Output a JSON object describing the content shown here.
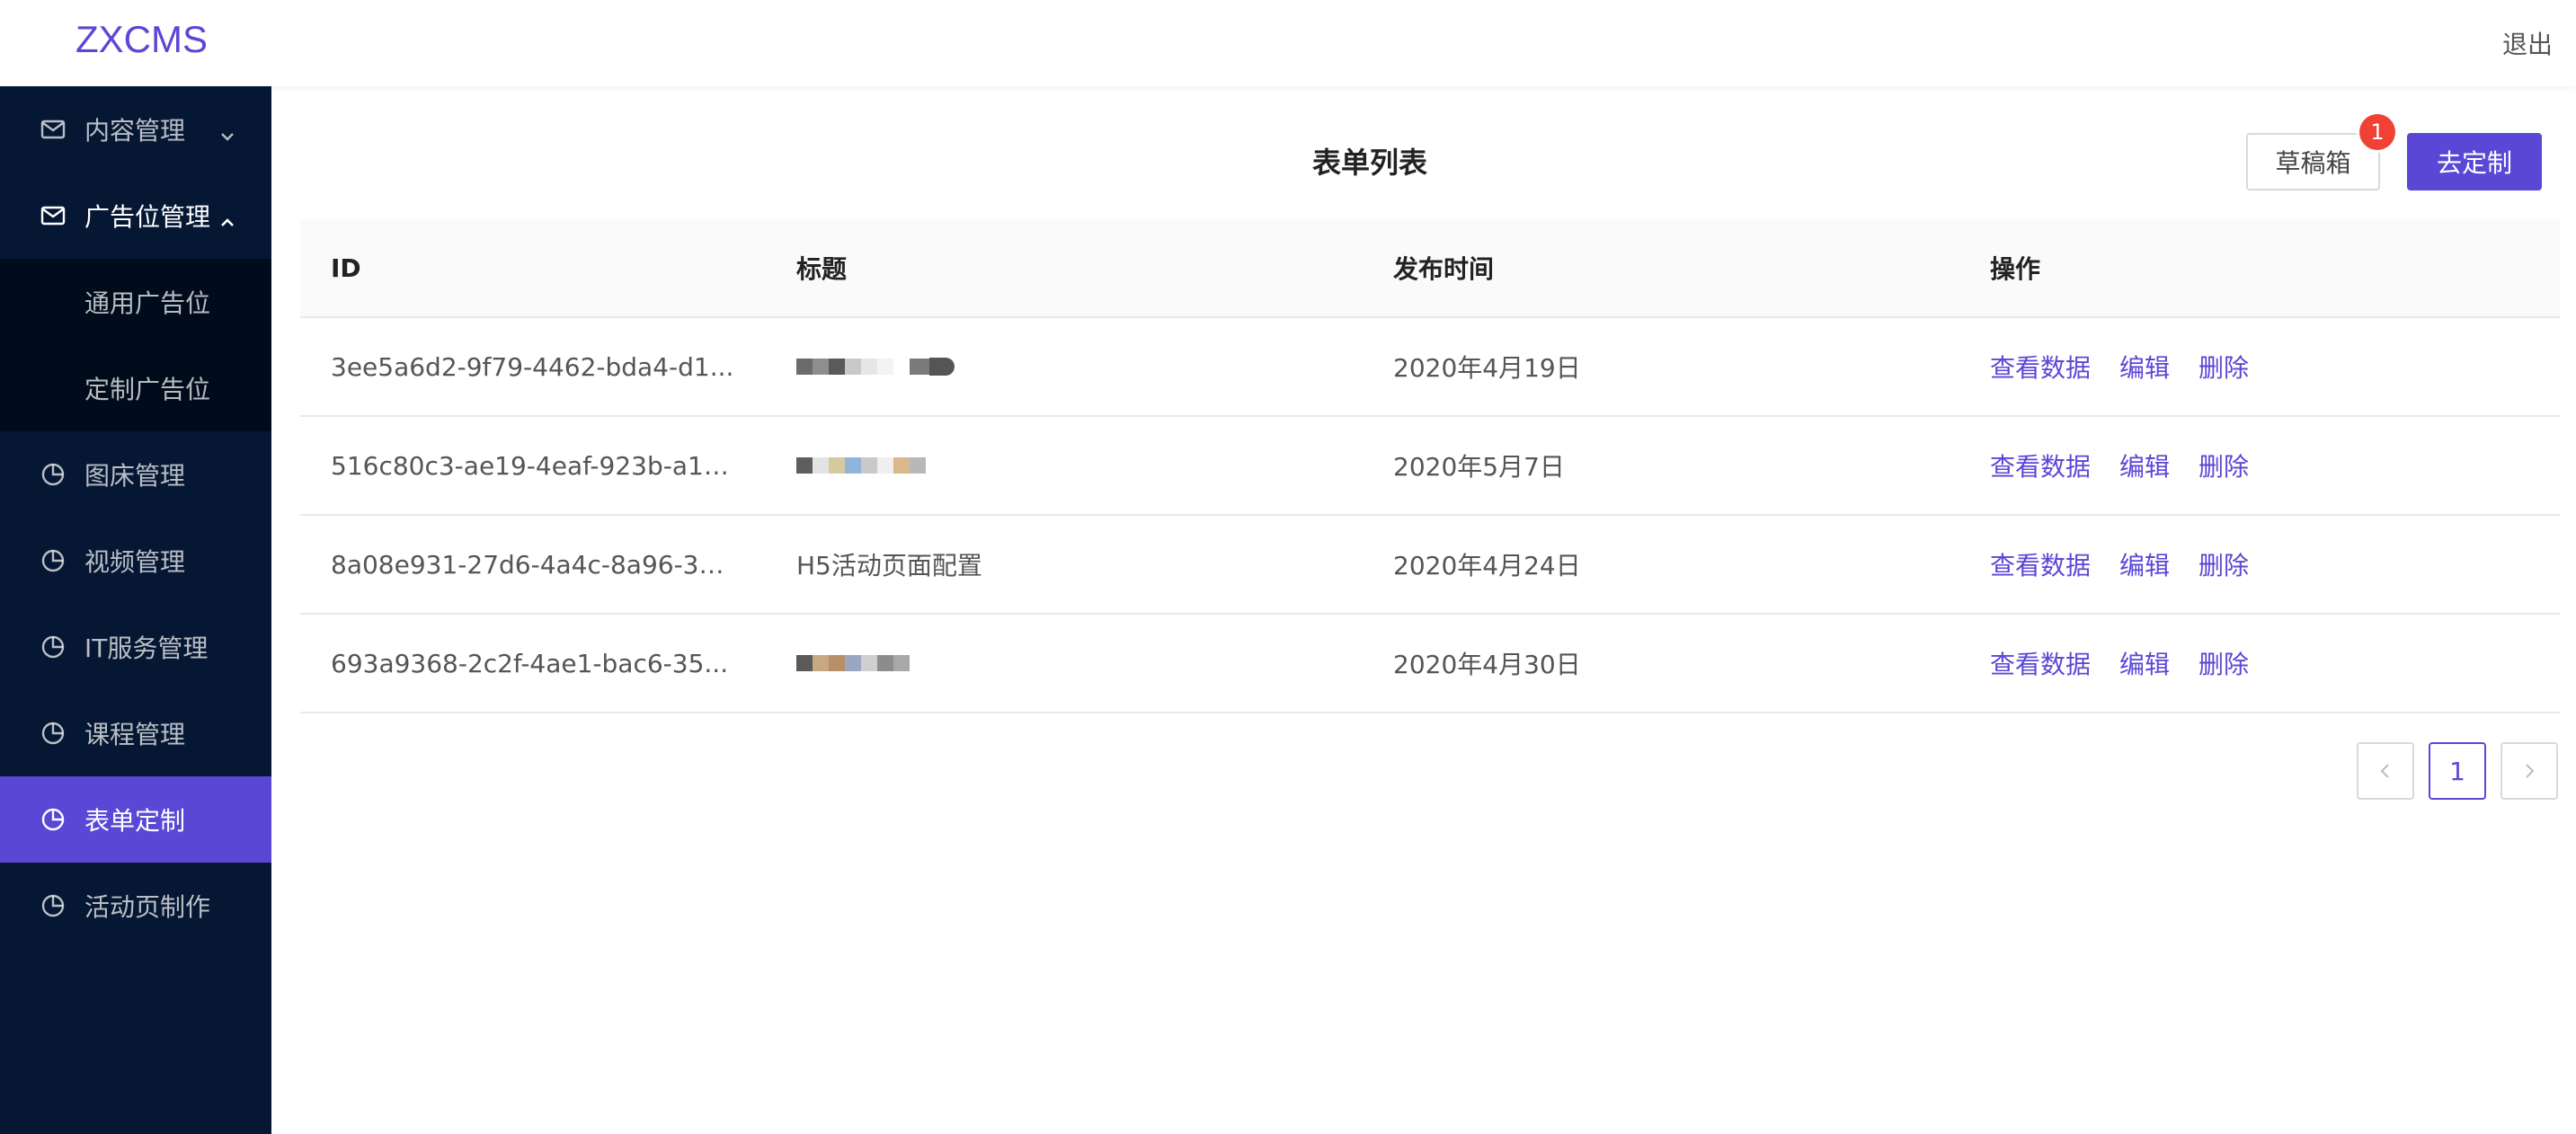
{
  "app": {
    "logo": "ZXCMS",
    "logout": "退出"
  },
  "sidebar": {
    "items": [
      {
        "label": "内容管理",
        "icon": "mail-icon"
      },
      {
        "label": "广告位管理",
        "icon": "mail-icon"
      },
      {
        "label": "图床管理",
        "icon": "pie-chart-icon"
      },
      {
        "label": "视频管理",
        "icon": "pie-chart-icon"
      },
      {
        "label": "IT服务管理",
        "icon": "pie-chart-icon"
      },
      {
        "label": "课程管理",
        "icon": "pie-chart-icon"
      },
      {
        "label": "表单定制",
        "icon": "pie-chart-icon"
      },
      {
        "label": "活动页制作",
        "icon": "pie-chart-icon"
      }
    ],
    "submenu": [
      {
        "label": "通用广告位"
      },
      {
        "label": "定制广告位"
      }
    ],
    "active_color": "#5b47d6",
    "bg_color": "#061733"
  },
  "main": {
    "title": "表单列表",
    "draft_button": "草稿箱",
    "draft_badge": "1",
    "custom_button": "去定制"
  },
  "table": {
    "headers": {
      "id": "ID",
      "title": "标题",
      "time": "发布时间",
      "ops": "操作"
    },
    "rows": [
      {
        "id": "3ee5a6d2-9f79-4462-bda4-d1...",
        "title": "",
        "time": "2020年4月19日"
      },
      {
        "id": "516c80c3-ae19-4eaf-923b-a1e...",
        "title": "",
        "time": "2020年5月7日"
      },
      {
        "id": "8a08e931-27d6-4a4c-8a96-39...",
        "title": "H5活动页面配置",
        "time": "2020年4月24日"
      },
      {
        "id": "693a9368-2c2f-4ae1-bac6-35...",
        "title": "",
        "time": "2020年4月30日"
      }
    ],
    "actions": {
      "view": "查看数据",
      "edit": "编辑",
      "delete": "删除"
    }
  },
  "pagination": {
    "prev": "<",
    "current": "1",
    "next": ">"
  }
}
